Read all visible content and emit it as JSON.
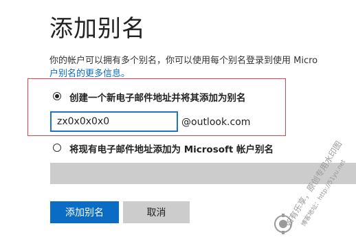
{
  "page": {
    "title": "添加别名",
    "description_line1": "你的帐户可以拥有多个别名，你可以使用每个别名登录到使用 Micro",
    "description_line2": "户别名的更多信息。"
  },
  "option_new": {
    "label": "创建一个新电子邮件地址并将其添加为别名",
    "selected": true,
    "input_value": "zx0x0x0x0",
    "domain": "@outlook.com"
  },
  "option_existing": {
    "label": "将现有电子邮件地址添加为 Microsoft 帐户别名",
    "selected": false
  },
  "buttons": {
    "add": "添加别名",
    "cancel": "取消"
  },
  "watermark": {
    "line1": "如有乐享，原创专用水印图",
    "line2": "博客地址：http://51yu.net"
  },
  "colors": {
    "accent": "#0a6cc4",
    "highlight_border": "#d9434a",
    "disabled_field": "#cccccc"
  }
}
